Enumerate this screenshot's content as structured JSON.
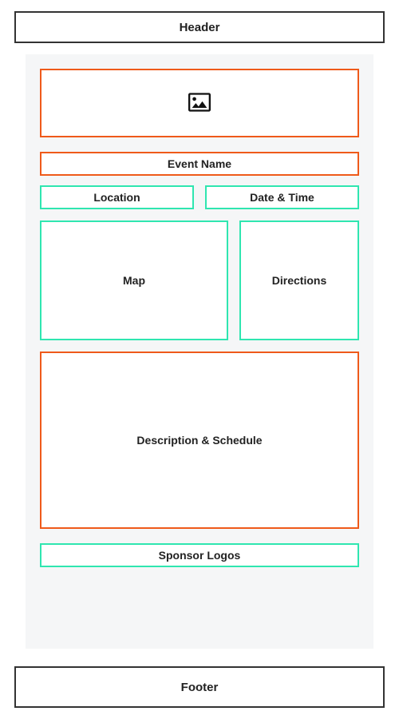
{
  "header": {
    "label": "Header"
  },
  "main": {
    "hero_icon": "image-placeholder-icon",
    "event_name": "Event Name",
    "location": "Location",
    "date_time": "Date & Time",
    "map": "Map",
    "directions": "Directions",
    "description": "Description & Schedule",
    "sponsors": "Sponsor Logos"
  },
  "footer": {
    "label": "Footer"
  },
  "colors": {
    "orange": "#ef5a1a",
    "teal": "#2fe6b0",
    "dark": "#333333"
  }
}
